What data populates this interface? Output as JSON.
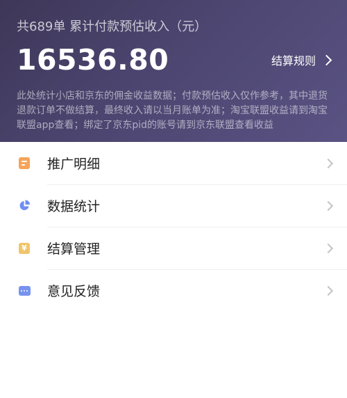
{
  "header": {
    "summary": "共689单 累计付款预估收入（元）",
    "amount": "16536.80",
    "settle_rule": "结算规则",
    "note": "此处统计小店和京东的佣金收益数据；付款预估收入仅作参考，其中退货退款订单不做结算，最终收入请以当月账单为准；淘宝联盟收益请到淘宝联盟app查看；绑定了京东pid的账号请到京东联盟查看收益"
  },
  "menu": [
    {
      "label": "推广明细",
      "icon": "document-icon",
      "color": "#f5a45a"
    },
    {
      "label": "数据统计",
      "icon": "pie-chart-icon",
      "color": "#6e8ef2"
    },
    {
      "label": "结算管理",
      "icon": "yen-icon",
      "color": "#f0c56a"
    },
    {
      "label": "意见反馈",
      "icon": "chat-bubble-icon",
      "color": "#7793f0"
    }
  ],
  "colors": {
    "header_start": "#3e3758",
    "header_end": "#5a5383"
  }
}
